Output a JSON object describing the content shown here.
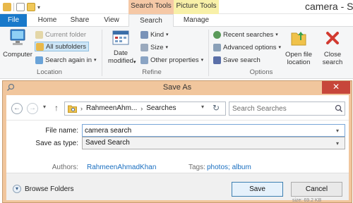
{
  "window": {
    "title": "camera - Sea",
    "context_tabs": [
      "Search Tools",
      "Picture Tools"
    ]
  },
  "tabs": {
    "file": "File",
    "home": "Home",
    "share": "Share",
    "view": "View",
    "search": "Search",
    "manage": "Manage"
  },
  "ribbon": {
    "location": {
      "label": "Location",
      "computer": "Computer",
      "current_folder": "Current folder",
      "all_subfolders": "All subfolders",
      "search_again": "Search again in"
    },
    "refine": {
      "label": "Refine",
      "date_modified_1": "Date",
      "date_modified_2": "modified",
      "kind": "Kind",
      "size": "Size",
      "other_properties": "Other properties"
    },
    "options": {
      "label": "Options",
      "recent_searches": "Recent searches",
      "advanced_options": "Advanced options",
      "save_search": "Save search",
      "open_file_location_1": "Open file",
      "open_file_location_2": "location",
      "close_search_1": "Close",
      "close_search_2": "search"
    }
  },
  "dialog": {
    "title": "Save As",
    "close": "✕",
    "address": {
      "crumbs": [
        "RahmeenAhm...",
        "Searches"
      ]
    },
    "search": {
      "placeholder": "Search Searches"
    },
    "file_name": {
      "label": "File name:",
      "value": "camera search"
    },
    "save_as_type": {
      "label": "Save as type:",
      "value": "Saved Search"
    },
    "authors": {
      "label": "Authors:",
      "value": "RahmeenAhmadKhan"
    },
    "tags": {
      "label": "Tags:",
      "value": "photos; album"
    },
    "browse_folders": "Browse Folders",
    "save_button": "Save",
    "cancel_button": "Cancel"
  },
  "status_peek": "size: 69.2 KB",
  "colors": {
    "file_tab": "#1979ca",
    "search_tools": "#f5c8a6",
    "picture_tools": "#f8f0a8",
    "dialog_frame": "#f1c69d",
    "close_button": "#c7463a",
    "link": "#1a6fc0"
  }
}
